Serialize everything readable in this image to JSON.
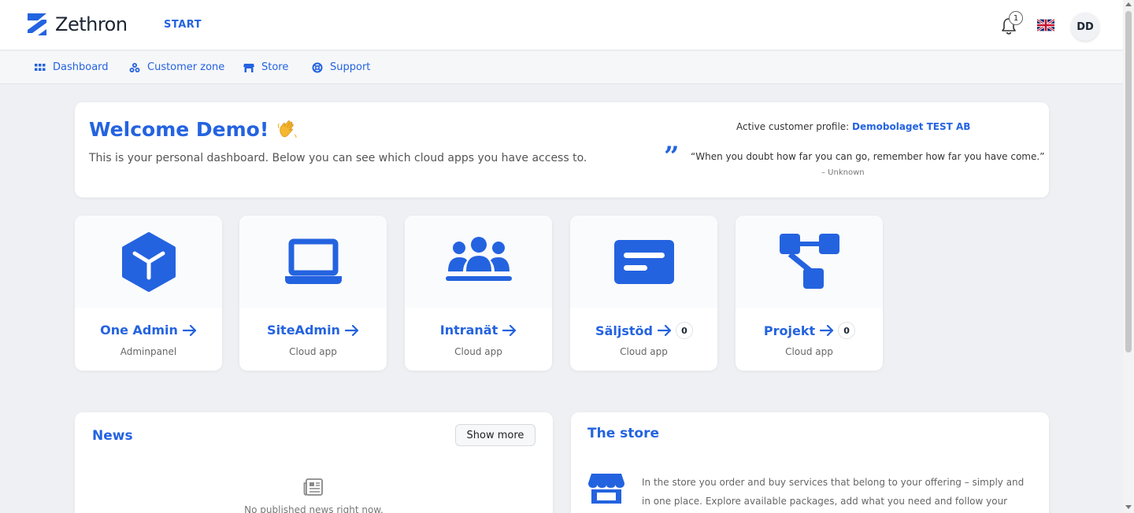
{
  "brand": {
    "name": "Zethron"
  },
  "header": {
    "start_label": "START",
    "notification_count": "1",
    "avatar_initials": "DD",
    "language": "English (UK)"
  },
  "nav": {
    "items": [
      {
        "label": "Dashboard",
        "icon": "grid-icon"
      },
      {
        "label": "Customer zone",
        "icon": "users-icon"
      },
      {
        "label": "Store",
        "icon": "store-icon"
      },
      {
        "label": "Support",
        "icon": "lifebuoy-icon"
      }
    ]
  },
  "welcome": {
    "title": "Welcome Demo!",
    "emoji": "👋",
    "subtitle": "This is your personal dashboard. Below you can see which cloud apps you have access to.",
    "profile_label": "Active customer profile: ",
    "profile_name": "Demobolaget TEST AB",
    "quote": "“When you doubt how far you can go, remember how far you have come.”",
    "quote_author": "– Unknown"
  },
  "apps": [
    {
      "name": "One Admin",
      "subtitle": "Adminpanel",
      "icon": "cube-icon",
      "count": null
    },
    {
      "name": "SiteAdmin",
      "subtitle": "Cloud app",
      "icon": "laptop-icon",
      "count": null
    },
    {
      "name": "Intranät",
      "subtitle": "Cloud app",
      "icon": "people-icon",
      "count": null
    },
    {
      "name": "Säljstöd",
      "subtitle": "Cloud app",
      "icon": "message-icon",
      "count": "0"
    },
    {
      "name": "Projekt",
      "subtitle": "Cloud app",
      "icon": "diagram-icon",
      "count": "0"
    }
  ],
  "news": {
    "title": "News",
    "show_more_label": "Show more",
    "empty_text": "No published news right now."
  },
  "store": {
    "title": "The store",
    "text": "In the store you order and buy services that belong to your offering – simply and in one place. Explore available packages, add what you need and follow your order"
  },
  "colors": {
    "accent": "#2463e0",
    "background": "#eef0f4",
    "text": "#333333"
  }
}
